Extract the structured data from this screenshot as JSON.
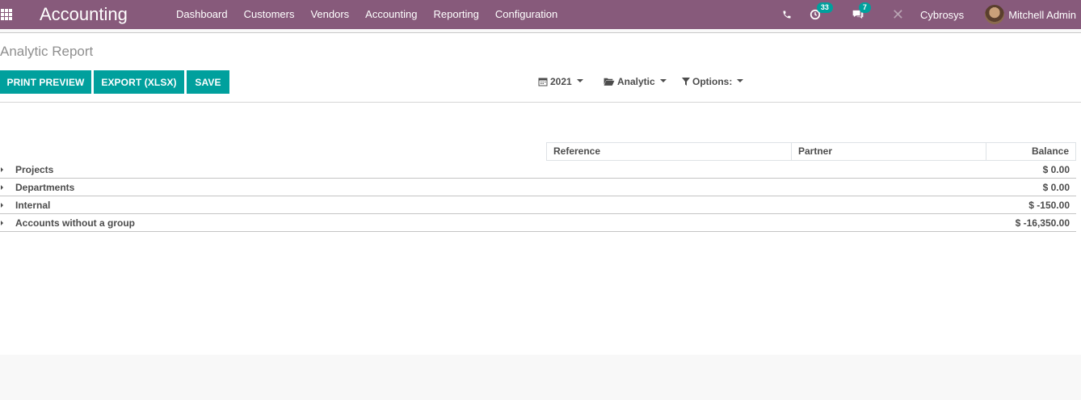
{
  "navbar": {
    "app_title": "Accounting",
    "menu": [
      "Dashboard",
      "Customers",
      "Vendors",
      "Accounting",
      "Reporting",
      "Configuration"
    ],
    "activity_count": "33",
    "message_count": "7",
    "company": "Cybrosys",
    "user": "Mitchell Admin"
  },
  "page": {
    "title": "Analytic Report",
    "buttons": {
      "print": "PRINT PREVIEW",
      "export": "EXPORT (XLSX)",
      "save": "SAVE"
    },
    "filters": {
      "period": "2021",
      "analytic": "Analytic",
      "options": "Options:"
    }
  },
  "table": {
    "headers": [
      "Reference",
      "Partner",
      "Balance"
    ],
    "rows": [
      {
        "name": "Projects",
        "balance": "$ 0.00"
      },
      {
        "name": "Departments",
        "balance": "$ 0.00"
      },
      {
        "name": "Internal",
        "balance": "$ -150.00"
      },
      {
        "name": "Accounts without a group",
        "balance": "$ -16,350.00"
      }
    ]
  },
  "colors": {
    "brand": "#875a7b",
    "accent": "#00a09d"
  }
}
